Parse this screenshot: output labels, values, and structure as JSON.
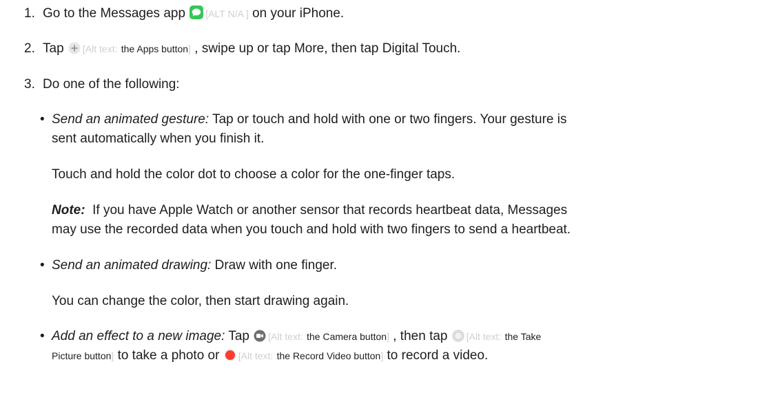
{
  "steps": {
    "s1": {
      "num": "1.",
      "a": "Go to the Messages app",
      "alt_open": "[ALT N/A ]",
      "b": "on your iPhone."
    },
    "s2": {
      "num": "2.",
      "a": "Tap",
      "alt_prefix": "[Alt text:",
      "alt_value": "the Apps button",
      "alt_close": "]",
      "b": ", swipe up or tap More, then tap Digital Touch."
    },
    "s3": {
      "num": "3.",
      "a": "Do one of the following:"
    }
  },
  "gesture": {
    "label": "Send an animated gesture:",
    "text1": "Tap or touch and hold with one or two fingers. Your gesture is",
    "text2": "sent automatically when you finish it.",
    "para": "Touch and hold the color dot to choose a color for the one-finger taps.",
    "note_label": "Note:",
    "note1": "If you have Apple Watch or another sensor that records heartbeat data, Messages",
    "note2": "may use the recorded data when you touch and hold with two fingers to send a heartbeat."
  },
  "drawing": {
    "label": "Send an animated drawing:",
    "text": "Draw with one finger.",
    "para": "You can change the color, then start drawing again."
  },
  "effect": {
    "label": "Add an effect to a new image:",
    "tap": "Tap",
    "alt_prefix": "[Alt text:",
    "camera_alt": "the Camera button",
    "alt_close": "]",
    "then_tap": ", then tap",
    "take_alt_1": "the Take",
    "take_alt_2": "Picture button",
    "to_take": "to take a photo or",
    "record_alt": "the Record Video button",
    "to_record": "to record a video."
  },
  "icons": {
    "messages": "messages-app-icon",
    "apps": "apps-plus-icon",
    "camera": "camera-icon",
    "take_picture": "shutter-icon",
    "record": "record-icon"
  },
  "colors": {
    "messages_green": "#34c759",
    "record_red": "#ff3b30"
  }
}
